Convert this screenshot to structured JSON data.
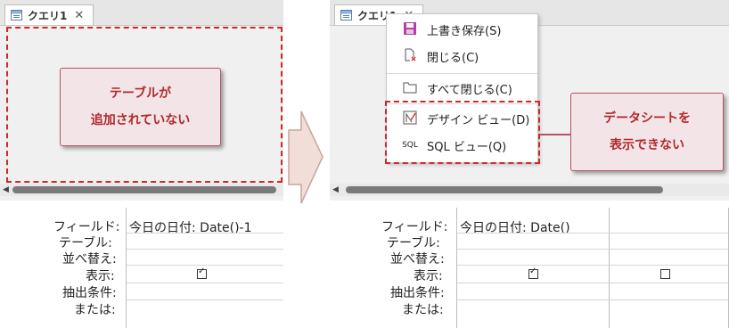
{
  "left": {
    "tab_label": "クエリ1",
    "callout_lines": [
      "テーブルが",
      "追加されていない"
    ],
    "row_labels": [
      "フィールド:",
      "テーブル:",
      "並べ替え:",
      "表示:",
      "抽出条件:",
      "または:"
    ],
    "field_cell": "今日の日付: Date()-1",
    "show_checked": true
  },
  "right": {
    "tab_label": "クエリ1",
    "row_labels": [
      "フィールド:",
      "テーブル:",
      "並べ替え:",
      "表示:",
      "抽出条件:",
      "または:"
    ],
    "field_cell": "今日の日付: Date()",
    "show_checked_col1": true,
    "show_checked_col2": false,
    "menu": {
      "save": "上書き保存(S)",
      "close": "閉じる(C)",
      "close_all": "すべて閉じる(C)",
      "design_view": "デザイン ビュー(D)",
      "sql_icon": "SQL",
      "sql_view": "SQL ビュー(Q)"
    },
    "callout_lines": [
      "データシートを",
      "表示できない"
    ]
  },
  "colors": {
    "highlight": "#cf2828",
    "callout_bg": "#f3e4e8",
    "callout_text": "#b02a2a",
    "arrow_fill": "#f2ded9"
  }
}
